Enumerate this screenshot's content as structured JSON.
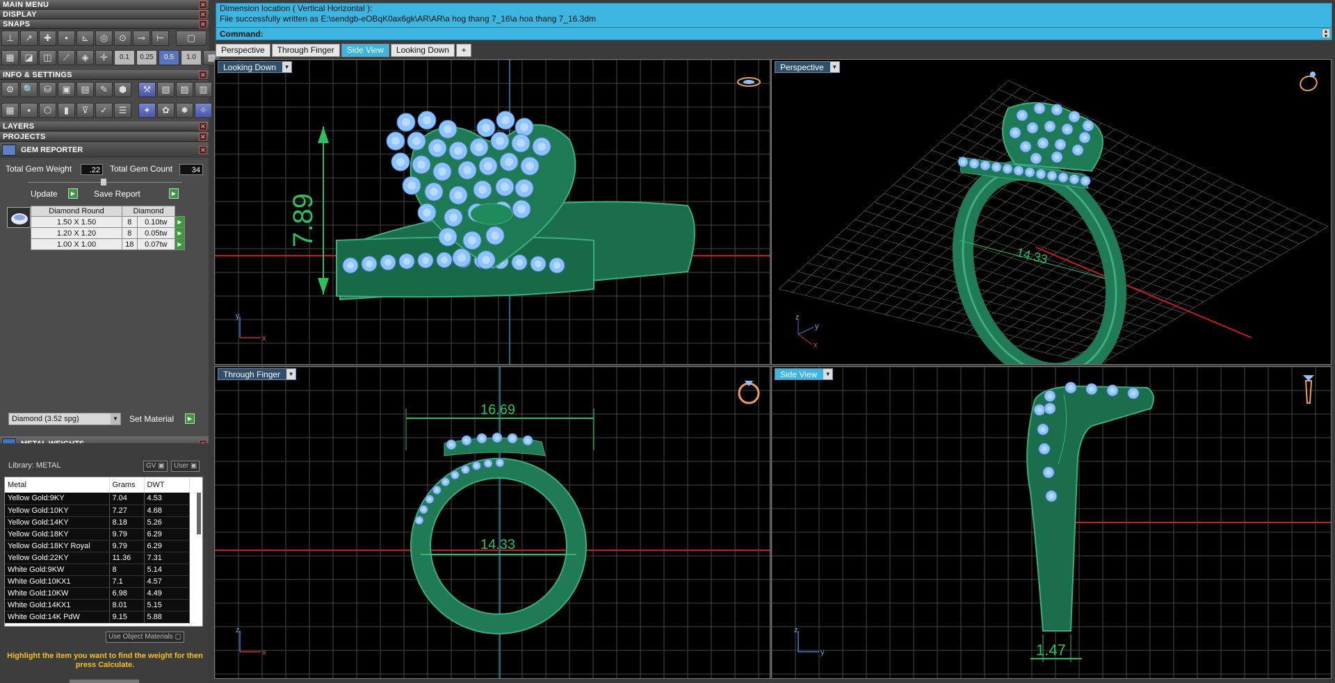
{
  "menus": [
    {
      "label": "MAIN MENU"
    },
    {
      "label": "DISPLAY"
    },
    {
      "label": "SNAPS"
    }
  ],
  "snap_steps": [
    "0.1",
    "0.25",
    "0.5",
    "1.0"
  ],
  "info_settings": {
    "label": "INFO & SETTINGS"
  },
  "layers": {
    "label": "LAYERS"
  },
  "projects": {
    "label": "PROJECTS"
  },
  "gem_reporter": {
    "title": "GEM REPORTER",
    "total_weight_label": "Total Gem Weight",
    "total_weight_value": ".22",
    "total_count_label": "Total Gem Count",
    "total_count_value": "34",
    "update_label": "Update",
    "save_report_label": "Save Report",
    "table_headers": [
      "Diamond Round",
      "Diamond"
    ],
    "rows": [
      {
        "size": "1.50 X 1.50",
        "count": "8",
        "weight": "0.10tw"
      },
      {
        "size": "1.20 X 1.20",
        "count": "8",
        "weight": "0.05tw"
      },
      {
        "size": "1.00 X 1.00",
        "count": "18",
        "weight": "0.07tw"
      }
    ],
    "material_value": "Diamond    (3.52 spg)",
    "set_material_label": "Set Material"
  },
  "metal_weights": {
    "title": "METAL WEIGHTS",
    "library_label": "Library: METAL",
    "gv_label": "GV",
    "user_label": "User",
    "headers": [
      "Metal",
      "Grams",
      "DWT"
    ],
    "rows": [
      {
        "metal": "Yellow Gold:9KY",
        "grams": "7.04",
        "dwt": "4.53"
      },
      {
        "metal": "Yellow Gold:10KY",
        "grams": "7.27",
        "dwt": "4.68"
      },
      {
        "metal": "Yellow Gold:14KY",
        "grams": "8.18",
        "dwt": "5.26"
      },
      {
        "metal": "Yellow Gold:18KY",
        "grams": "9.79",
        "dwt": "6.29"
      },
      {
        "metal": "Yellow Gold:18KY Royal",
        "grams": "9.79",
        "dwt": "6.29"
      },
      {
        "metal": "Yellow Gold:22KY",
        "grams": "11.36",
        "dwt": "7.31"
      },
      {
        "metal": "White Gold:9KW",
        "grams": "8",
        "dwt": "5.14"
      },
      {
        "metal": "White Gold:10KX1",
        "grams": "7.1",
        "dwt": "4.57"
      },
      {
        "metal": "White Gold:10KW",
        "grams": "6.98",
        "dwt": "4.49"
      },
      {
        "metal": "White Gold:14KX1",
        "grams": "8.01",
        "dwt": "5.15"
      },
      {
        "metal": "White Gold:14K PdW",
        "grams": "9.15",
        "dwt": "5.88"
      }
    ],
    "use_object_materials_label": "Use Object Materials",
    "hint": "Highlight the item you want to find the weight for then press Calculate."
  },
  "command": {
    "line1": "Dimension location ( Vertical  Horizontal ):",
    "line2": "File successfully written as E:\\sendgb-eOBqK0ax6gk\\AR\\AR\\a hog thang 7_16\\a hoa thang 7_16.3dm",
    "prompt": "Command:"
  },
  "tabs": [
    "Perspective",
    "Through Finger",
    "Side View",
    "Looking Down"
  ],
  "active_tab": "Side View",
  "viewports": {
    "top_left": {
      "label": "Looking Down",
      "dimension": "7.89"
    },
    "top_right": {
      "label": "Perspective",
      "dimension": "14.33"
    },
    "bottom_left": {
      "label": "Through Finger",
      "dim_width": "16.69",
      "dim_inner": "14.33"
    },
    "bottom_right": {
      "label": "Side View",
      "dimension": "1.47"
    }
  },
  "axes": {
    "x": "x",
    "y": "y",
    "z": "z"
  },
  "colors": {
    "ring": "#1f7a55",
    "ring_light": "#3fae7e",
    "gem": "#8ec3ff",
    "grid": "#5a5a5a",
    "dimension": "#2fbf5f",
    "accent": "#3cb5e0"
  }
}
